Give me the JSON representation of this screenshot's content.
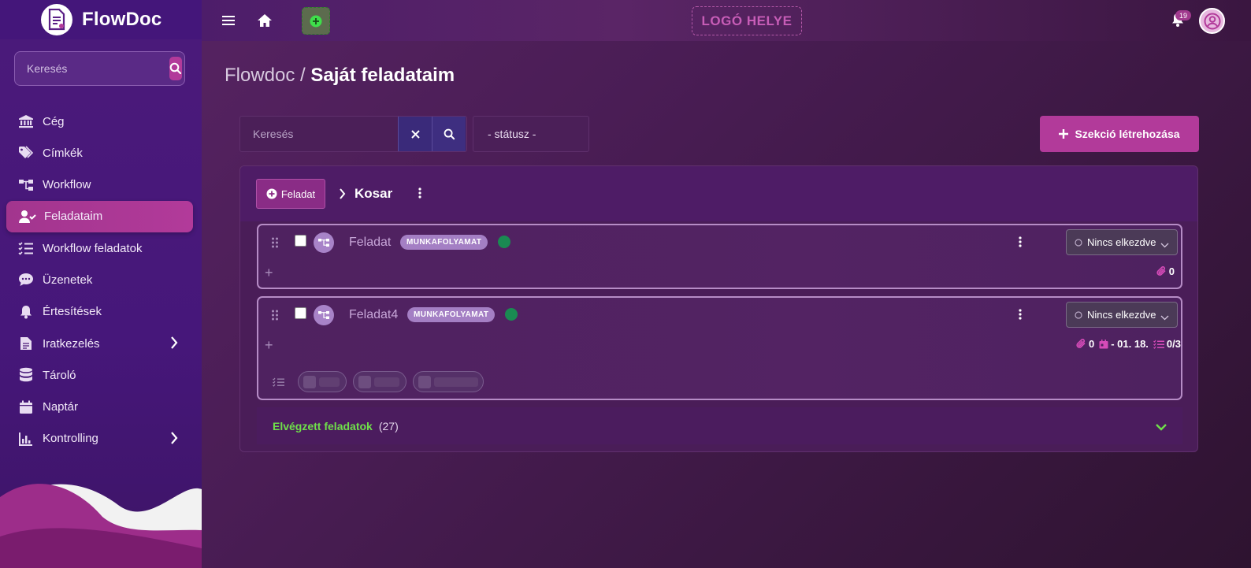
{
  "app": {
    "name": "FlowDoc"
  },
  "sidebar": {
    "search_placeholder": "Keresés",
    "items": [
      {
        "label": "Cég",
        "icon": "bank-icon"
      },
      {
        "label": "Címkék",
        "icon": "tags-icon"
      },
      {
        "label": "Workflow",
        "icon": "workflow-icon"
      },
      {
        "label": "Feladataim",
        "icon": "user-check-icon",
        "active": true
      },
      {
        "label": "Workflow feladatok",
        "icon": "checklist-icon"
      },
      {
        "label": "Üzenetek",
        "icon": "chat-icon"
      },
      {
        "label": "Értesítések",
        "icon": "bell-icon"
      },
      {
        "label": "Iratkezelés",
        "icon": "document-icon",
        "has_submenu": true
      },
      {
        "label": "Tároló",
        "icon": "database-icon"
      },
      {
        "label": "Naptár",
        "icon": "calendar-icon"
      },
      {
        "label": "Kontrolling",
        "icon": "bar-chart-icon",
        "has_submenu": true
      }
    ]
  },
  "topbar": {
    "logo_placeholder": "LOGÓ HELYE",
    "notification_count": "19"
  },
  "breadcrumb": {
    "root": "Flowdoc",
    "separator": " / ",
    "current": "Saját feladataim"
  },
  "filters": {
    "search_placeholder": "Keresés",
    "status_placeholder": "- státusz -",
    "create_section_label": "Szekció létrehozása"
  },
  "section": {
    "add_task_label": "Feladat",
    "title": "Kosar",
    "tasks": [
      {
        "title": "Feladat",
        "tag": "MUNKAFOLYAMAT",
        "status": "Nincs elkezdve",
        "attachments": "0"
      },
      {
        "title": "Feladat4",
        "tag": "MUNKAFOLYAMAT",
        "status": "Nincs elkezdve",
        "attachments": "0",
        "due_date": "- 01. 18.",
        "checklist": "0/3"
      }
    ],
    "completed_label": "Elvégzett feladatok",
    "completed_count": "(27)"
  },
  "colors": {
    "accent": "#b23a9a",
    "sidebar": "#46177a",
    "completed_green": "#6fe04a",
    "status_dot": "#1a8a52"
  }
}
